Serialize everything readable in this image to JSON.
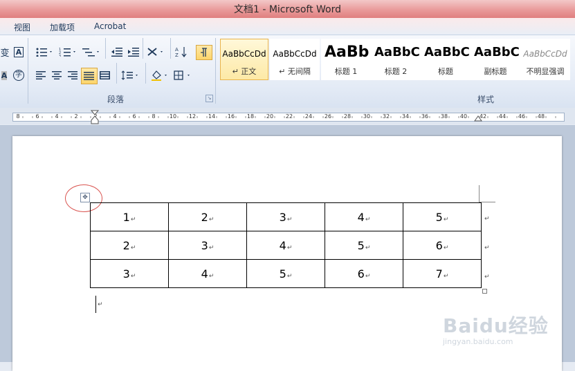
{
  "window": {
    "title": "文档1 - Microsoft Word"
  },
  "tabs": [
    {
      "label": "视图"
    },
    {
      "label": "加载项"
    },
    {
      "label": "Acrobat"
    }
  ],
  "ribbon": {
    "paragraph_group_label": "段落",
    "styles_group_label": "样式",
    "left_partial_icons": [
      "phonetic-guide-icon",
      "character-border-icon",
      "character-shading-icon",
      "enclosed-character-icon"
    ],
    "paragraph_icons": [
      "bullets-icon",
      "numbering-icon",
      "multilevel-list-icon",
      "decrease-indent-icon",
      "increase-indent-icon",
      "chinese-layout-icon",
      "sort-icon",
      "show-formatting-marks-icon",
      "align-left-icon",
      "center-icon",
      "align-right-icon",
      "justify-icon",
      "distributed-icon",
      "line-spacing-icon",
      "shading-icon",
      "borders-icon"
    ],
    "styles": [
      {
        "sample": "AaBbCcDd",
        "name": "↵ 正文",
        "active": true
      },
      {
        "sample": "AaBbCcDd",
        "name": "↵ 无间隔",
        "active": false
      },
      {
        "sample": "AaBb",
        "name": "标题 1",
        "active": false
      },
      {
        "sample": "AaBbC",
        "name": "标题 2",
        "active": false
      },
      {
        "sample": "AaBbC",
        "name": "标题",
        "active": false
      },
      {
        "sample": "AaBbC",
        "name": "副标题",
        "active": false
      },
      {
        "sample": "AaBbCcDd",
        "name": "不明显强调",
        "active": false
      }
    ]
  },
  "ruler": {
    "labels": [
      "8",
      "6",
      "4",
      "2",
      "2",
      "4",
      "6",
      "8",
      "10",
      "12",
      "14",
      "16",
      "18",
      "20",
      "22",
      "24",
      "26",
      "28",
      "30",
      "32",
      "34",
      "36",
      "38",
      "40",
      "42",
      "44",
      "46",
      "48"
    ]
  },
  "document": {
    "table": [
      [
        "1",
        "2",
        "3",
        "4",
        "5"
      ],
      [
        "2",
        "3",
        "4",
        "5",
        "6"
      ],
      [
        "3",
        "4",
        "5",
        "6",
        "7"
      ]
    ],
    "cell_mark": "↵",
    "move_handle_icon": "table-move-handle-icon"
  },
  "watermark": {
    "line1": "Baidu经验",
    "line2": "jingyan.baidu.com"
  },
  "colors": {
    "titlebar": "#e07f7f",
    "ribbon": "#e4ebf6",
    "active_style": "#fde9a6",
    "annotation_circle": "#d9534f"
  }
}
